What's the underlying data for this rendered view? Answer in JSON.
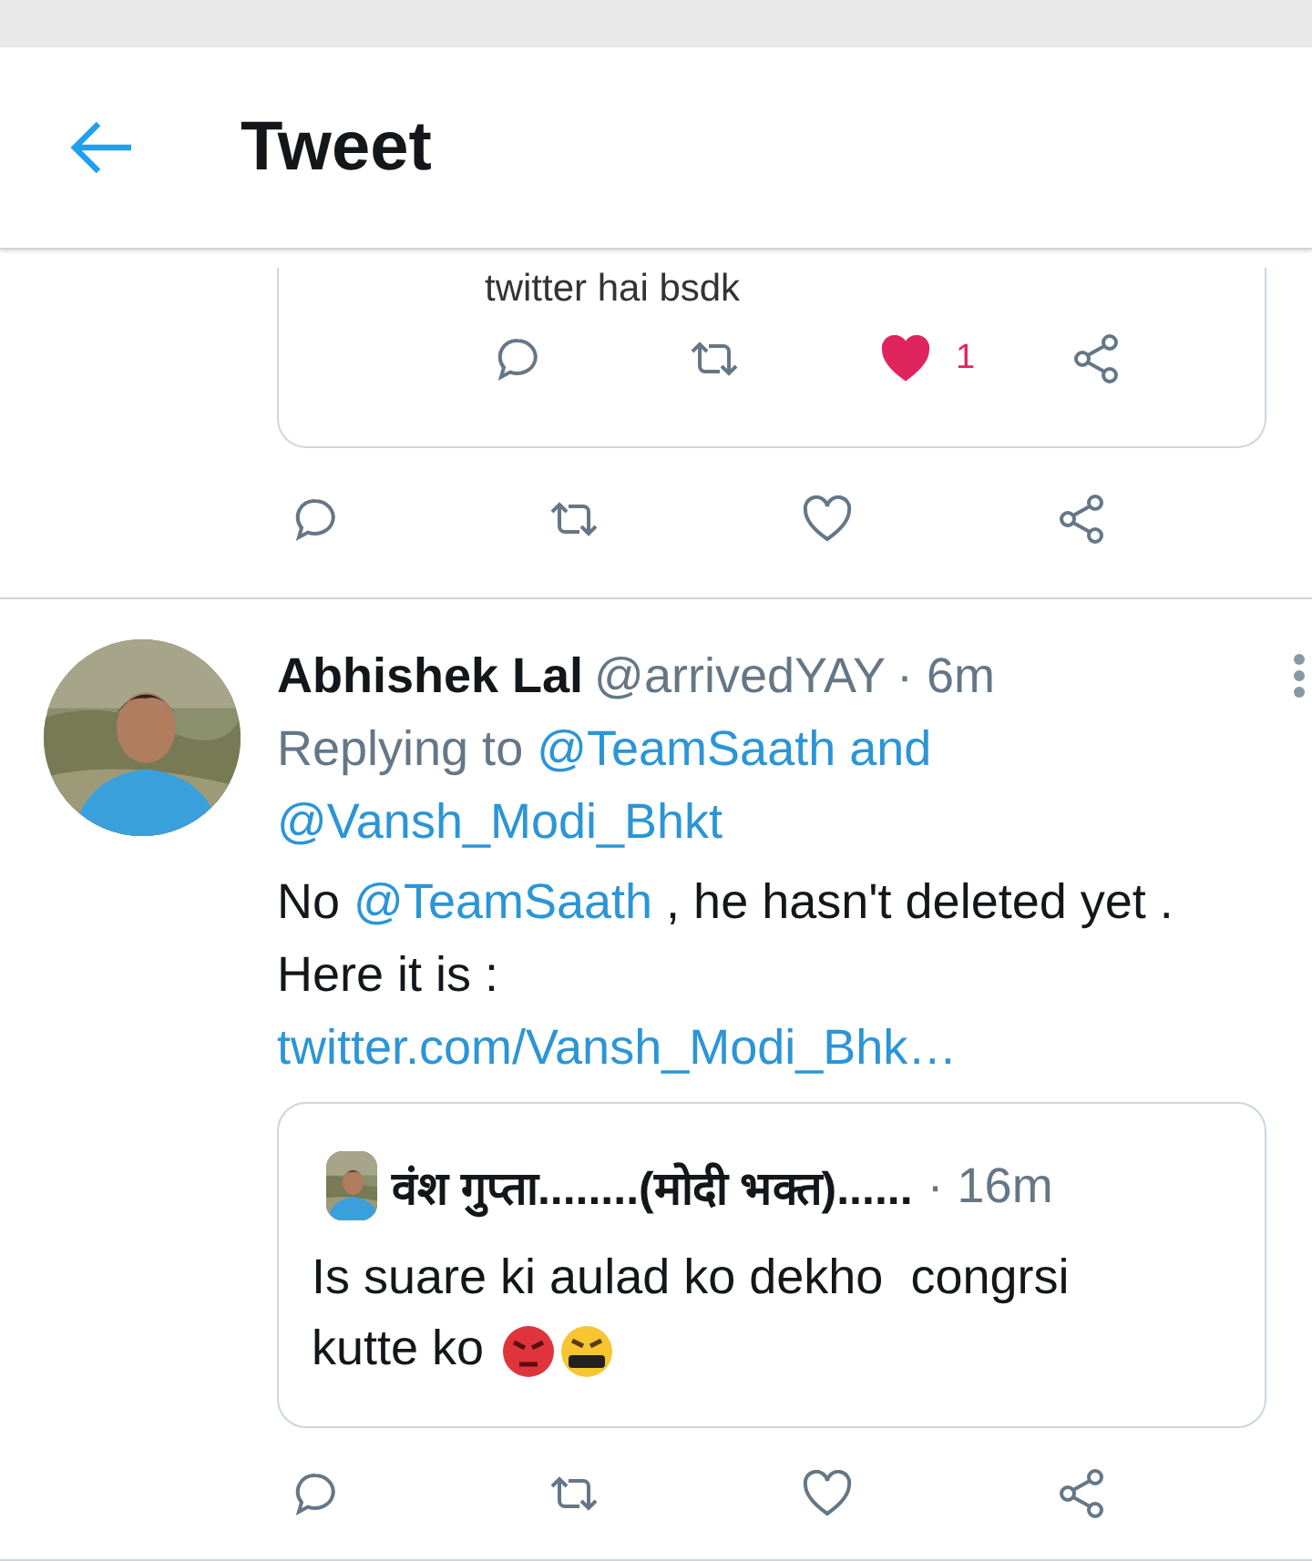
{
  "header": {
    "title": "Tweet"
  },
  "quoted_above": {
    "text": "twitter hai bsdk",
    "actions": [
      {
        "kind": "reply"
      },
      {
        "kind": "retweet"
      },
      {
        "kind": "like",
        "liked": true,
        "count": "1"
      },
      {
        "kind": "share"
      }
    ]
  },
  "parent_actions": [
    {
      "kind": "reply"
    },
    {
      "kind": "retweet"
    },
    {
      "kind": "like",
      "liked": false
    },
    {
      "kind": "share"
    }
  ],
  "reply": {
    "name": "Abhishek Lal",
    "handle": "@arrivedYAY",
    "time": "· 6m",
    "replying_prefix": "Replying to",
    "replying_targets": [
      "@TeamSaath and",
      "@Vansh_Modi_Bhkt"
    ],
    "body": [
      {
        "kind": "text",
        "text": "No"
      },
      {
        "kind": "mention",
        "text": "@TeamSaath"
      },
      {
        "kind": "text",
        "text": ", he hasn't deleted yet . Here it is :"
      },
      {
        "kind": "link",
        "text": "twitter.com/Vansh_Modi_Bhk…"
      }
    ],
    "quote": {
      "name": "वंश गुप्ता........(मोदी भक्त)......",
      "time": "· 16m",
      "text": "Is suare ki aulad ko dekho  congrsi kutte ko",
      "emojis": [
        {
          "kind": "angry"
        },
        {
          "kind": "cursing"
        }
      ]
    },
    "actions": [
      {
        "kind": "reply"
      },
      {
        "kind": "retweet"
      },
      {
        "kind": "like",
        "liked": false
      },
      {
        "kind": "share"
      }
    ]
  }
}
